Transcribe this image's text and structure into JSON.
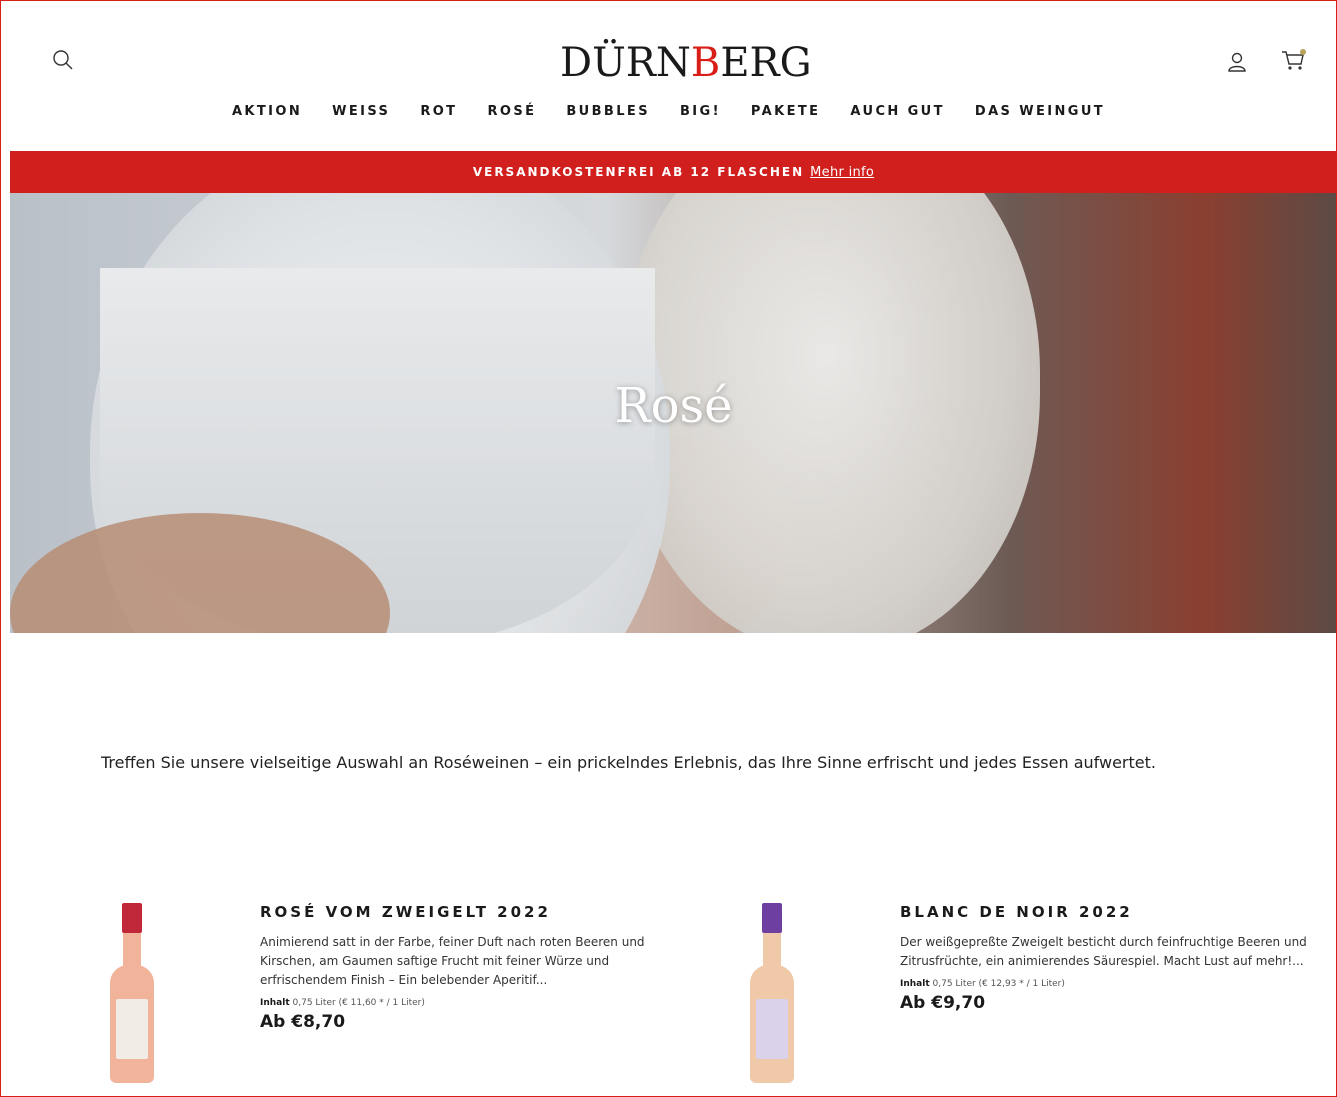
{
  "header": {
    "logo_prefix": "DÜRN",
    "logo_mark": "B",
    "logo_suffix": "ERG",
    "nav": [
      "AKTION",
      "WEISS",
      "ROT",
      "ROSÉ",
      "BUBBLES",
      "BIG!",
      "PAKETE",
      "AUCH GUT",
      "DAS WEINGUT"
    ],
    "icons": {
      "search": "search-icon",
      "account": "user-icon",
      "cart": "cart-icon"
    }
  },
  "announcement": {
    "text": "VERSANDKOSTENFREI AB 12 FLASCHEN",
    "link": "Mehr info"
  },
  "hero": {
    "title": "Rosé"
  },
  "intro": {
    "text": "Treffen Sie unsere vielseitige Auswahl an Roséweinen – ein prickelndes Erlebnis, das Ihre Sinne erfrischt und jedes Essen aufwertet."
  },
  "products": [
    {
      "title": "ROSÉ VOM ZWEIGELT 2022",
      "description": "Animierend satt in der Farbe, feiner Duft nach roten Beeren und Kirschen, am Gaumen saftige Frucht mit feiner Würze und erfrischendem Finish – Ein belebender Aperitif...",
      "unit_label": "Inhalt",
      "unit_value": "0,75 Liter (€ 11,60 * / 1 Liter)",
      "price": "Ab €8,70",
      "cap_color": "#c0283a"
    },
    {
      "title": "BLANC DE NOIR 2022",
      "description": "Der weißgepreßte Zweigelt besticht durch feinfruchtige Beeren und Zitrusfrüchte, ein animierendes Säurespiel. Macht Lust auf mehr!...",
      "unit_label": "Inhalt",
      "unit_value": "0,75 Liter (€ 12,93 * / 1 Liter)",
      "price": "Ab €9,70",
      "cap_color": "#6d3fa0"
    }
  ],
  "colors": {
    "brand_red": "#d01f1d"
  }
}
